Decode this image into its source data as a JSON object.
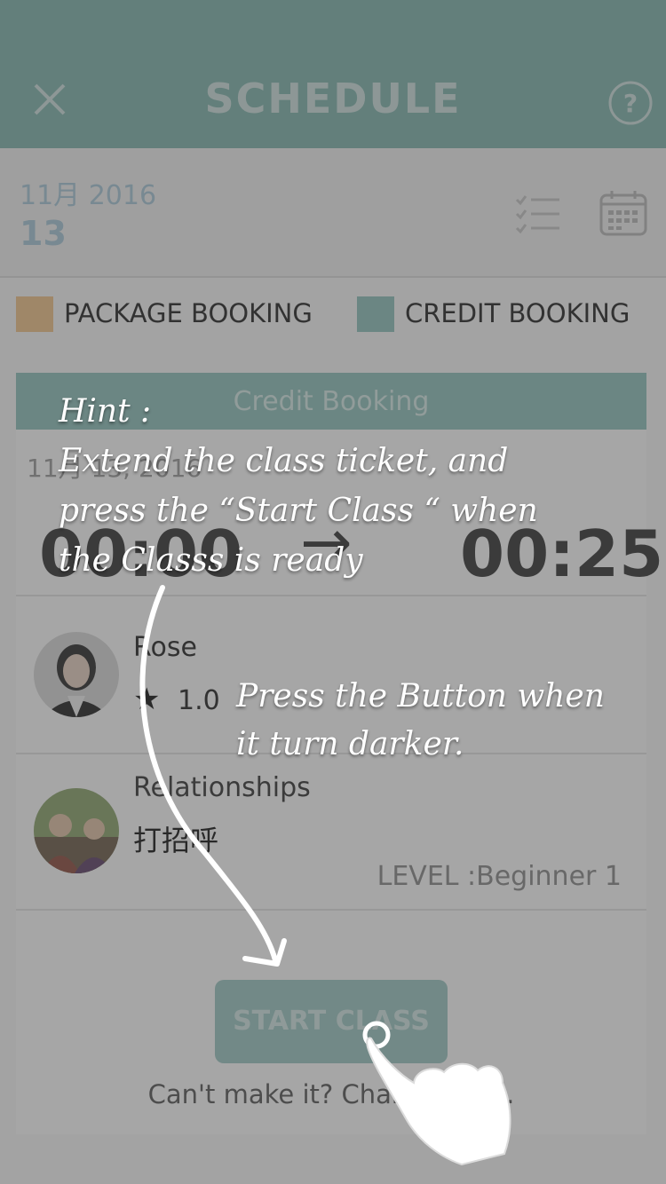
{
  "header": {
    "title": "SCHEDULE",
    "close_icon": "close-icon",
    "help_icon": "help-icon"
  },
  "date_bar": {
    "month": "11月 2016",
    "day": "13",
    "list_icon": "checklist-icon",
    "calendar_icon": "calendar-icon"
  },
  "legend": {
    "package_label": "PACKAGE BOOKING",
    "credit_label": "CREDIT BOOKING",
    "package_color": "#f1c489",
    "credit_color": "#8fc1bc"
  },
  "card": {
    "header": "Credit Booking",
    "date_line": "11月 13, 2016",
    "start_time": "00:00",
    "arrow": "→",
    "end_time": "00:25",
    "teacher": {
      "name": "Rose",
      "star": "★",
      "rating": "1.0"
    },
    "lesson": {
      "category": "Relationships",
      "title": "打招呼",
      "level": "LEVEL :Beginner 1"
    },
    "start_button": "START CLASS",
    "change_text": "Can't make it? Change ",
    "change_link": "here",
    "change_end": "."
  },
  "hints": {
    "line1": "Hint :",
    "line2": "Extend the class ticket, and",
    "line3": "press the “Start Class “ when",
    "line4": "the Classs is ready",
    "button_line1": "Press the Button when",
    "button_line2": "it turn darker."
  },
  "colors": {
    "header_bg": "#7fb5ad",
    "button_bg": "#9cc8c3",
    "accent_text": "#a8c8d8"
  }
}
